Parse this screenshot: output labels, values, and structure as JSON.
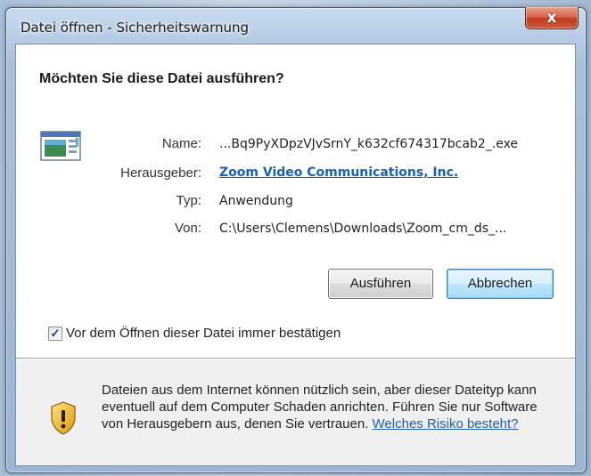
{
  "window": {
    "title": "Datei öffnen - Sicherheitswarnung",
    "close_glyph": "x"
  },
  "dialog": {
    "heading": "Möchten Sie diese Datei ausführen?",
    "fields": [
      {
        "label": "Name:",
        "value": "...Bq9PyXDpzVJvSrnY_k632cf674317bcab2_.exe"
      },
      {
        "label": "Herausgeber:",
        "value": "Zoom Video Communications, Inc."
      },
      {
        "label": "Typ:",
        "value": "Anwendung"
      },
      {
        "label": "Von:",
        "value": "C:\\Users\\Clemens\\Downloads\\Zoom_cm_ds_..."
      }
    ],
    "run_button": "Ausführen",
    "cancel_button": "Abbrechen",
    "always_confirm_checked": true,
    "always_confirm_label": "Vor dem Öffnen dieser Datei immer bestätigen",
    "warning_text": "Dateien aus dem Internet können nützlich sein, aber dieser Dateityp kann eventuell auf dem Computer Schaden anrichten. Führen Sie nur Software von Herausgebern aus, denen Sie vertrauen.",
    "warning_link": "Welches Risiko besteht?"
  },
  "icons": {
    "file": "application-file-icon",
    "shield": "security-shield-icon",
    "close": "close-icon",
    "check": "checkmark-icon"
  },
  "colors": {
    "link": "#1c5fb8",
    "close_button": "#c1391c",
    "default_button_border": "#3c7fb1"
  }
}
